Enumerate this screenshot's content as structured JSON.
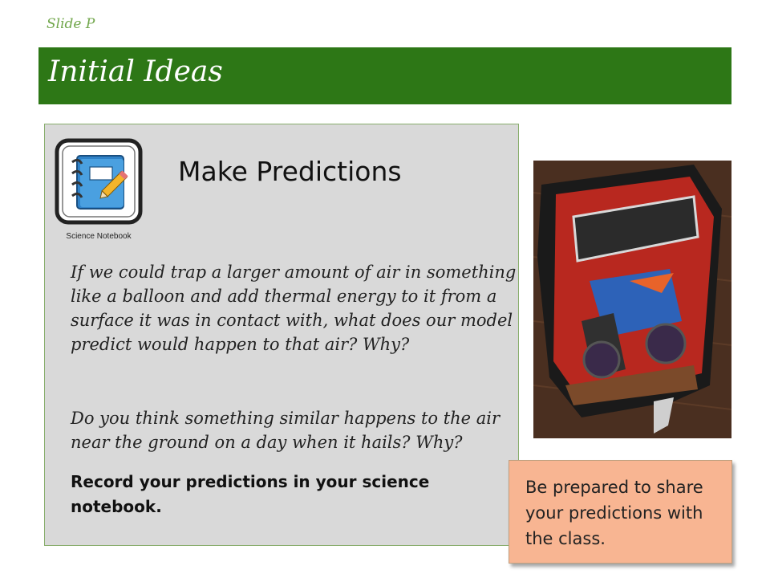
{
  "slide_label": "Slide P",
  "title": "Initial Ideas",
  "notebook": {
    "icon": "notebook-pencil-icon",
    "caption": "Science Notebook"
  },
  "heading": "Make Predictions",
  "paragraph_1": "If we could trap a larger amount of air in something like a balloon and add thermal energy to it from a surface it was in contact with, what does our model predict would happen to that air? Why?",
  "paragraph_2": "Do you think something similar happens to the air near the ground on a day when it hails? Why?",
  "record_instruction": "Record your predictions in your science notebook.",
  "share_note": "Be prepared to share your predictions with the class.",
  "colors": {
    "title_bar": "#2d7716",
    "content_bg": "#d9d9d9",
    "share_bg": "#f8b592"
  }
}
